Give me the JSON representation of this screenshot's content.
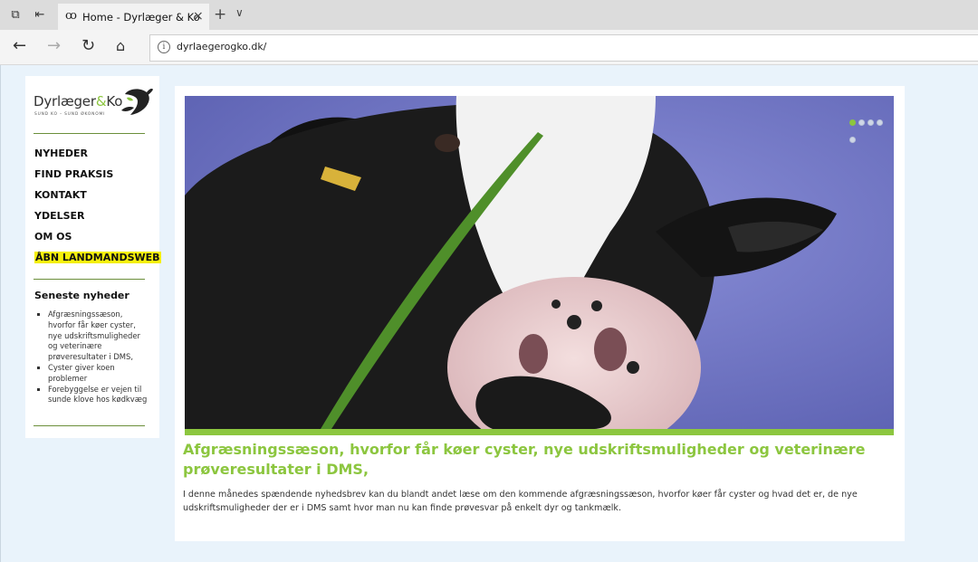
{
  "browser": {
    "tab": {
      "title": "Home - Dyrlæger & Ko",
      "favicon": "cow-logo-icon"
    },
    "address": {
      "url": "dyrlaegerogko.dk/"
    },
    "icons": [
      "back-arrow-icon",
      "forward-arrow-icon",
      "refresh-icon",
      "home-icon",
      "info-icon",
      "close-icon",
      "new-tab-icon",
      "tab-menu-chevron-icon"
    ]
  },
  "sidebar": {
    "logo": {
      "word_left": "Dyrlæger",
      "word_amp": "&",
      "word_right": "Ko",
      "tagline": "SUND KO – SUND ØKONOMI"
    },
    "menu": [
      {
        "label": "NYHEDER"
      },
      {
        "label": "FIND PRAKSIS"
      },
      {
        "label": "KONTAKT"
      },
      {
        "label": "YDELSER"
      },
      {
        "label": "OM OS"
      },
      {
        "label": "ÅBN LANDMANDSWEB"
      }
    ],
    "news_heading": "Seneste nyheder",
    "news": [
      "Afgræsningssæson, hvorfor får køer cyster, nye udskriftsmuligheder og veterinære prøveresultater i DMS,",
      "Cyster giver koen problemer",
      "Forebyggelse er vejen til sunde klove hos kødkvæg"
    ]
  },
  "main": {
    "slider": {
      "count": 5,
      "active": 1
    },
    "headline": "Afgræsningssæson, hvorfor får køer cyster, nye udskriftsmuligheder og veterinære prøveresultater i DMS,",
    "lead": "I denne månedes spændende nyhedsbrev kan du blandt andet læse om den kommende afgræsningssæson, hvorfor køer får cyster og hvad det er, de nye udskriftsmuligheder der er i DMS samt hvor man nu kan finde prøvesvar på enkelt dyr og tankmælk."
  },
  "colors": {
    "accent": "#8cc63f",
    "highlight": "#f5f00a",
    "page_bg": "#e9f3fb",
    "hero_bg": "#6f73c2"
  }
}
